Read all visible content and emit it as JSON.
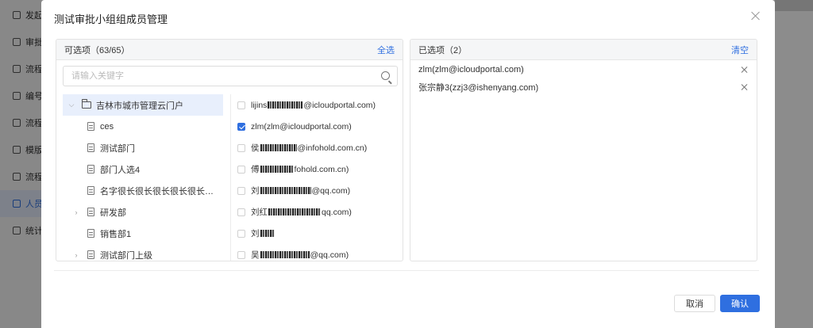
{
  "background": {
    "sidebar_items": [
      {
        "label": "发起",
        "icon": "edit-icon"
      },
      {
        "label": "审批",
        "icon": "edit-icon"
      },
      {
        "label": "流程",
        "icon": "gear-icon"
      },
      {
        "label": "编号",
        "icon": "gear-icon"
      },
      {
        "label": "流程",
        "icon": "search-icon"
      },
      {
        "label": "模版",
        "icon": "file-icon"
      },
      {
        "label": "流程",
        "icon": "grid-icon"
      },
      {
        "label": "人员",
        "icon": "users-icon"
      },
      {
        "label": "统计",
        "icon": "chart-icon"
      }
    ]
  },
  "dialog": {
    "title": "测试审批小组组成员管理",
    "left_panel": {
      "header": "可选项（63/65）",
      "select_all": "全选",
      "search_placeholder": "请输入关键字",
      "tree": [
        {
          "label": "吉林市城市管理云门户",
          "type": "folder",
          "expanded": true,
          "selected": true
        },
        {
          "label": "ces",
          "type": "file"
        },
        {
          "label": "测试部门",
          "type": "file"
        },
        {
          "label": "部门人选4",
          "type": "file"
        },
        {
          "label": "名字很长很长很长很长很长很长…",
          "type": "file"
        },
        {
          "label": "研发部",
          "type": "file",
          "collapsible": true
        },
        {
          "label": "销售部1",
          "type": "file"
        },
        {
          "label": "测试部门上级",
          "type": "file",
          "collapsible": true
        }
      ],
      "members": [
        {
          "prefix": "lijins",
          "suffix": "@icloudportal.com)",
          "checked": false
        },
        {
          "prefix": "zlm(zlm@icloudportal.com)",
          "suffix": "",
          "checked": true
        },
        {
          "prefix": "侯",
          "suffix": "@infohold.com.cn)",
          "checked": false
        },
        {
          "prefix": "傅",
          "suffix": "fohold.com.cn)",
          "checked": false
        },
        {
          "prefix": "刘",
          "suffix": "@qq.com)",
          "checked": false
        },
        {
          "prefix": "刘红",
          "suffix": "qq.com)",
          "checked": false
        },
        {
          "prefix": "刘",
          "suffix": "",
          "checked": false
        },
        {
          "prefix": "吴",
          "suffix": "@qq.com)",
          "checked": false
        }
      ]
    },
    "right_panel": {
      "header": "已选项（2）",
      "clear": "清空",
      "selected": [
        {
          "label": "zlm(zlm@icloudportal.com)"
        },
        {
          "label": "张宗静3(zzj3@ishenyang.com)"
        }
      ]
    },
    "buttons": {
      "cancel": "取消",
      "confirm": "确认"
    }
  }
}
